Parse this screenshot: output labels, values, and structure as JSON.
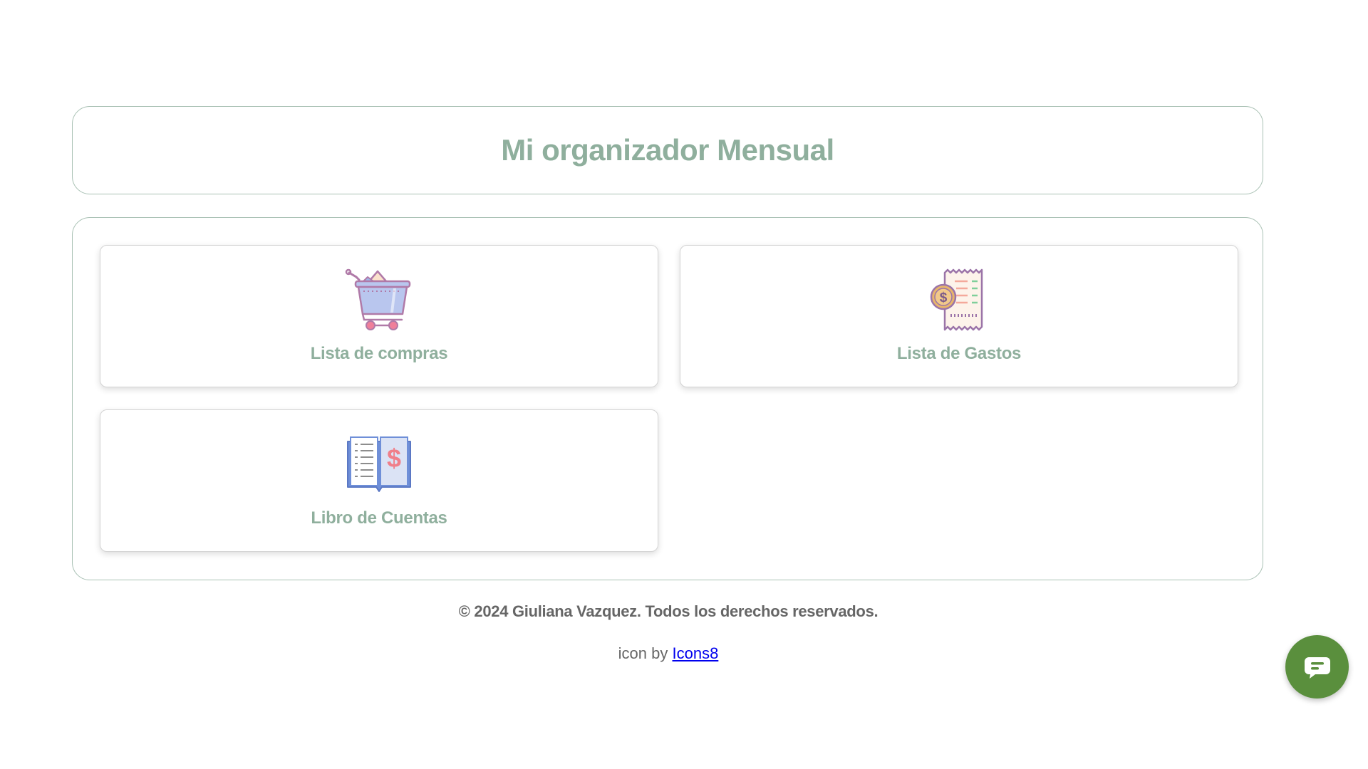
{
  "header": {
    "title": "Mi organizador Mensual"
  },
  "cards": [
    {
      "label": "Lista de compras",
      "icon": "shopping-cart-icon"
    },
    {
      "label": "Lista de Gastos",
      "icon": "receipt-icon"
    },
    {
      "label": "Libro de Cuentas",
      "icon": "account-book-icon"
    }
  ],
  "footer": {
    "copyright": "© 2024 Giuliana Vazquez. Todos los derechos reservados.",
    "credit_prefix": "icon by",
    "credit_link": "Icons8"
  },
  "chat_button": {
    "icon": "chat-icon"
  },
  "colors": {
    "accent": "#8faf9d",
    "border": "#a9c1b4",
    "chat_button": "#5a8f3d",
    "link": "#0000ee",
    "footer_text": "#666666"
  }
}
